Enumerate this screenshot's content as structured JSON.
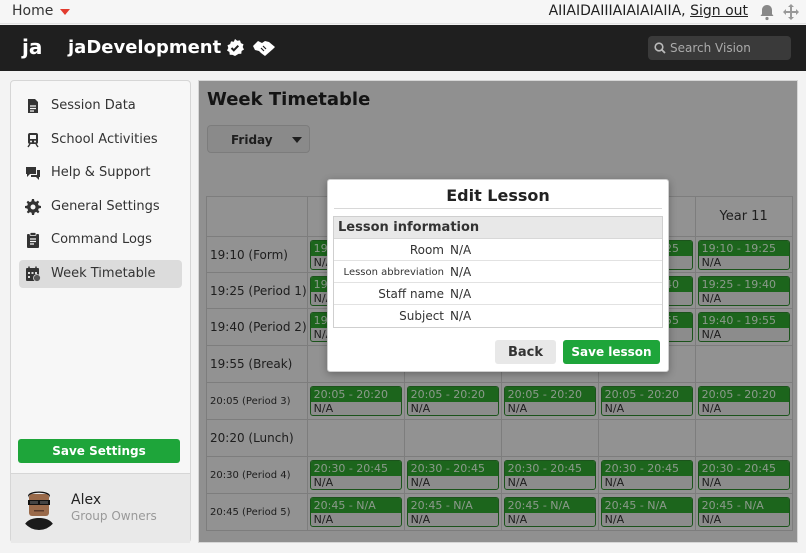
{
  "topbar": {
    "home_label": "Home",
    "username": "AIIAIDAIIIAIAIAIAIIA,",
    "signout_label": "Sign out"
  },
  "header": {
    "logo": "ja",
    "group_name": "jaDevelopment",
    "search_placeholder": "Search Vision"
  },
  "sidebar": {
    "items": [
      {
        "label": "Session Data",
        "icon": "document-icon"
      },
      {
        "label": "School Activities",
        "icon": "train-icon"
      },
      {
        "label": "Help & Support",
        "icon": "chat-icon"
      },
      {
        "label": "General Settings",
        "icon": "gear-icon"
      },
      {
        "label": "Command Logs",
        "icon": "clipboard-icon"
      },
      {
        "label": "Week Timetable",
        "icon": "calendar-icon"
      }
    ],
    "active_index": 5,
    "save_label": "Save Settings",
    "user": {
      "name": "Alex",
      "role": "Group Owners"
    }
  },
  "main": {
    "title": "Week Timetable",
    "day": "Friday",
    "columns": [
      "",
      "",
      "",
      "",
      "",
      "Year 11"
    ],
    "rows": [
      {
        "label": "19:10 (Form)",
        "small": false,
        "slots": [
          {
            "time": "19:10 - 19:25",
            "sub": "N/A"
          },
          {
            "time": "19:10 - 19:25",
            "sub": "N/A"
          },
          {
            "time": "19:10 - 19:25",
            "sub": "N/A"
          },
          {
            "time": "19:10 - 19:25",
            "sub": "N/A"
          },
          {
            "time": "19:10 - 19:25",
            "sub": "N/A"
          }
        ]
      },
      {
        "label": "19:25 (Period 1)",
        "small": false,
        "slots": [
          {
            "time": "19:25 - 19:40",
            "sub": "N/A"
          },
          {
            "time": "19:25 - 19:40",
            "sub": "N/A"
          },
          {
            "time": "19:25 - 19:40",
            "sub": "N/A"
          },
          {
            "time": "19:25 - 19:40",
            "sub": "N/A"
          },
          {
            "time": "19:25 - 19:40",
            "sub": "N/A"
          }
        ]
      },
      {
        "label": "19:40 (Period 2)",
        "small": false,
        "slots": [
          {
            "time": "19:40 - 19:55",
            "sub": "N/A"
          },
          {
            "time": "19:40 - 19:55",
            "sub": "N/A"
          },
          {
            "time": "19:40 - 19:55",
            "sub": "N/A"
          },
          {
            "time": "19:40 - 19:55",
            "sub": "N/A"
          },
          {
            "time": "19:40 - 19:55",
            "sub": "N/A"
          }
        ]
      },
      {
        "label": "19:55 (Break)",
        "small": false,
        "slots": []
      },
      {
        "label": "20:05 (Period 3)",
        "small": true,
        "slots": [
          {
            "time": "20:05 - 20:20",
            "sub": "N/A"
          },
          {
            "time": "20:05 - 20:20",
            "sub": "N/A"
          },
          {
            "time": "20:05 - 20:20",
            "sub": "N/A"
          },
          {
            "time": "20:05 - 20:20",
            "sub": "N/A"
          },
          {
            "time": "20:05 - 20:20",
            "sub": "N/A"
          }
        ]
      },
      {
        "label": "20:20 (Lunch)",
        "small": false,
        "slots": []
      },
      {
        "label": "20:30 (Period 4)",
        "small": true,
        "slots": [
          {
            "time": "20:30 - 20:45",
            "sub": "N/A"
          },
          {
            "time": "20:30 - 20:45",
            "sub": "N/A"
          },
          {
            "time": "20:30 - 20:45",
            "sub": "N/A"
          },
          {
            "time": "20:30 - 20:45",
            "sub": "N/A"
          },
          {
            "time": "20:30 - 20:45",
            "sub": "N/A"
          }
        ]
      },
      {
        "label": "20:45 (Period 5)",
        "small": true,
        "slots": [
          {
            "time": "20:45 - N/A",
            "sub": "N/A"
          },
          {
            "time": "20:45 - N/A",
            "sub": "N/A"
          },
          {
            "time": "20:45 - N/A",
            "sub": "N/A"
          },
          {
            "time": "20:45 - N/A",
            "sub": "N/A"
          },
          {
            "time": "20:45 - N/A",
            "sub": "N/A"
          }
        ]
      }
    ]
  },
  "modal": {
    "title": "Edit Lesson",
    "section": "Lesson information",
    "fields": [
      {
        "key": "Room",
        "value": "N/A"
      },
      {
        "key": "Lesson abbreviation",
        "value": "N/A"
      },
      {
        "key": "Staff name",
        "value": "N/A"
      },
      {
        "key": "Subject",
        "value": "N/A"
      }
    ],
    "back_label": "Back",
    "save_label": "Save lesson"
  },
  "colors": {
    "accent_green": "#1ea53a",
    "header_bg": "#1f1f1f",
    "slot_green": "#2fa82f"
  }
}
